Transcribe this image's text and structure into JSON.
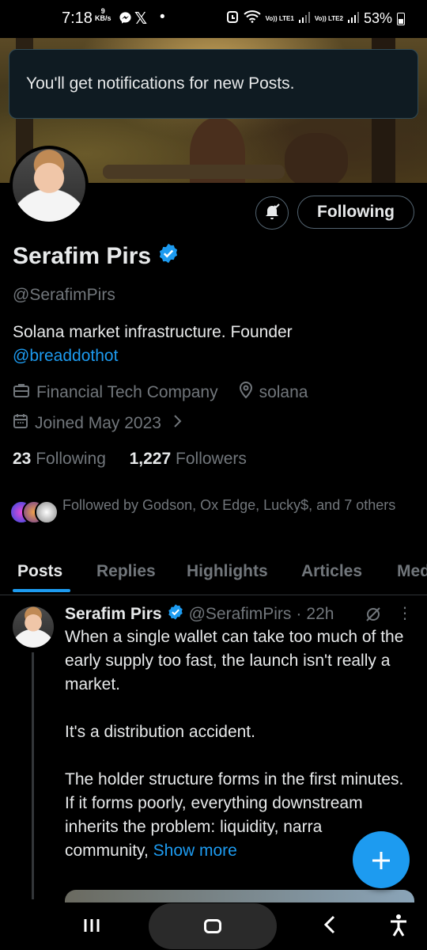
{
  "status_bar": {
    "time": "7:18",
    "speed_value": "9",
    "speed_unit": "KB/s",
    "notif_icons": [
      "messenger-icon",
      "x-icon",
      "dot"
    ],
    "lte1": "Vo)) LTE1",
    "lte2": "Vo)) LTE2",
    "battery": "53%"
  },
  "toast": {
    "text": "You'll get notifications for new Posts."
  },
  "profile": {
    "following_button": "Following",
    "name": "Serafim Pirs",
    "handle": "@SerafimPirs",
    "bio_text": "Solana market infrastructure. Founder",
    "bio_link": "@breaddothot",
    "category": "Financial Tech Company",
    "location": "solana",
    "joined": "Joined May 2023",
    "following_count": "23",
    "following_label": "Following",
    "followers_count": "1,227",
    "followers_label": "Followers",
    "followed_by": "Followed by Godson, Ox Edge, Lucky$, and 7 others"
  },
  "tabs": [
    {
      "label": "Posts",
      "active": true
    },
    {
      "label": "Replies"
    },
    {
      "label": "Highlights"
    },
    {
      "label": "Articles"
    },
    {
      "label": "Media"
    }
  ],
  "post": {
    "author": "Serafim Pirs",
    "handle": "@SerafimPirs",
    "separator": "·",
    "age": "22h",
    "para1": "When a single wallet can take too much of the early supply too fast, the launch isn't really a market.",
    "para2": "It's a distribution accident.",
    "para3": "The holder structure forms in the first minutes.",
    "para4": "If it forms poorly, everything downstream inherits the problem: liquidity, narra",
    "para5": "community, ",
    "show_more": "Show more"
  },
  "colors": {
    "accent": "#1d9bf0",
    "background": "#000000",
    "muted": "#71767b"
  }
}
